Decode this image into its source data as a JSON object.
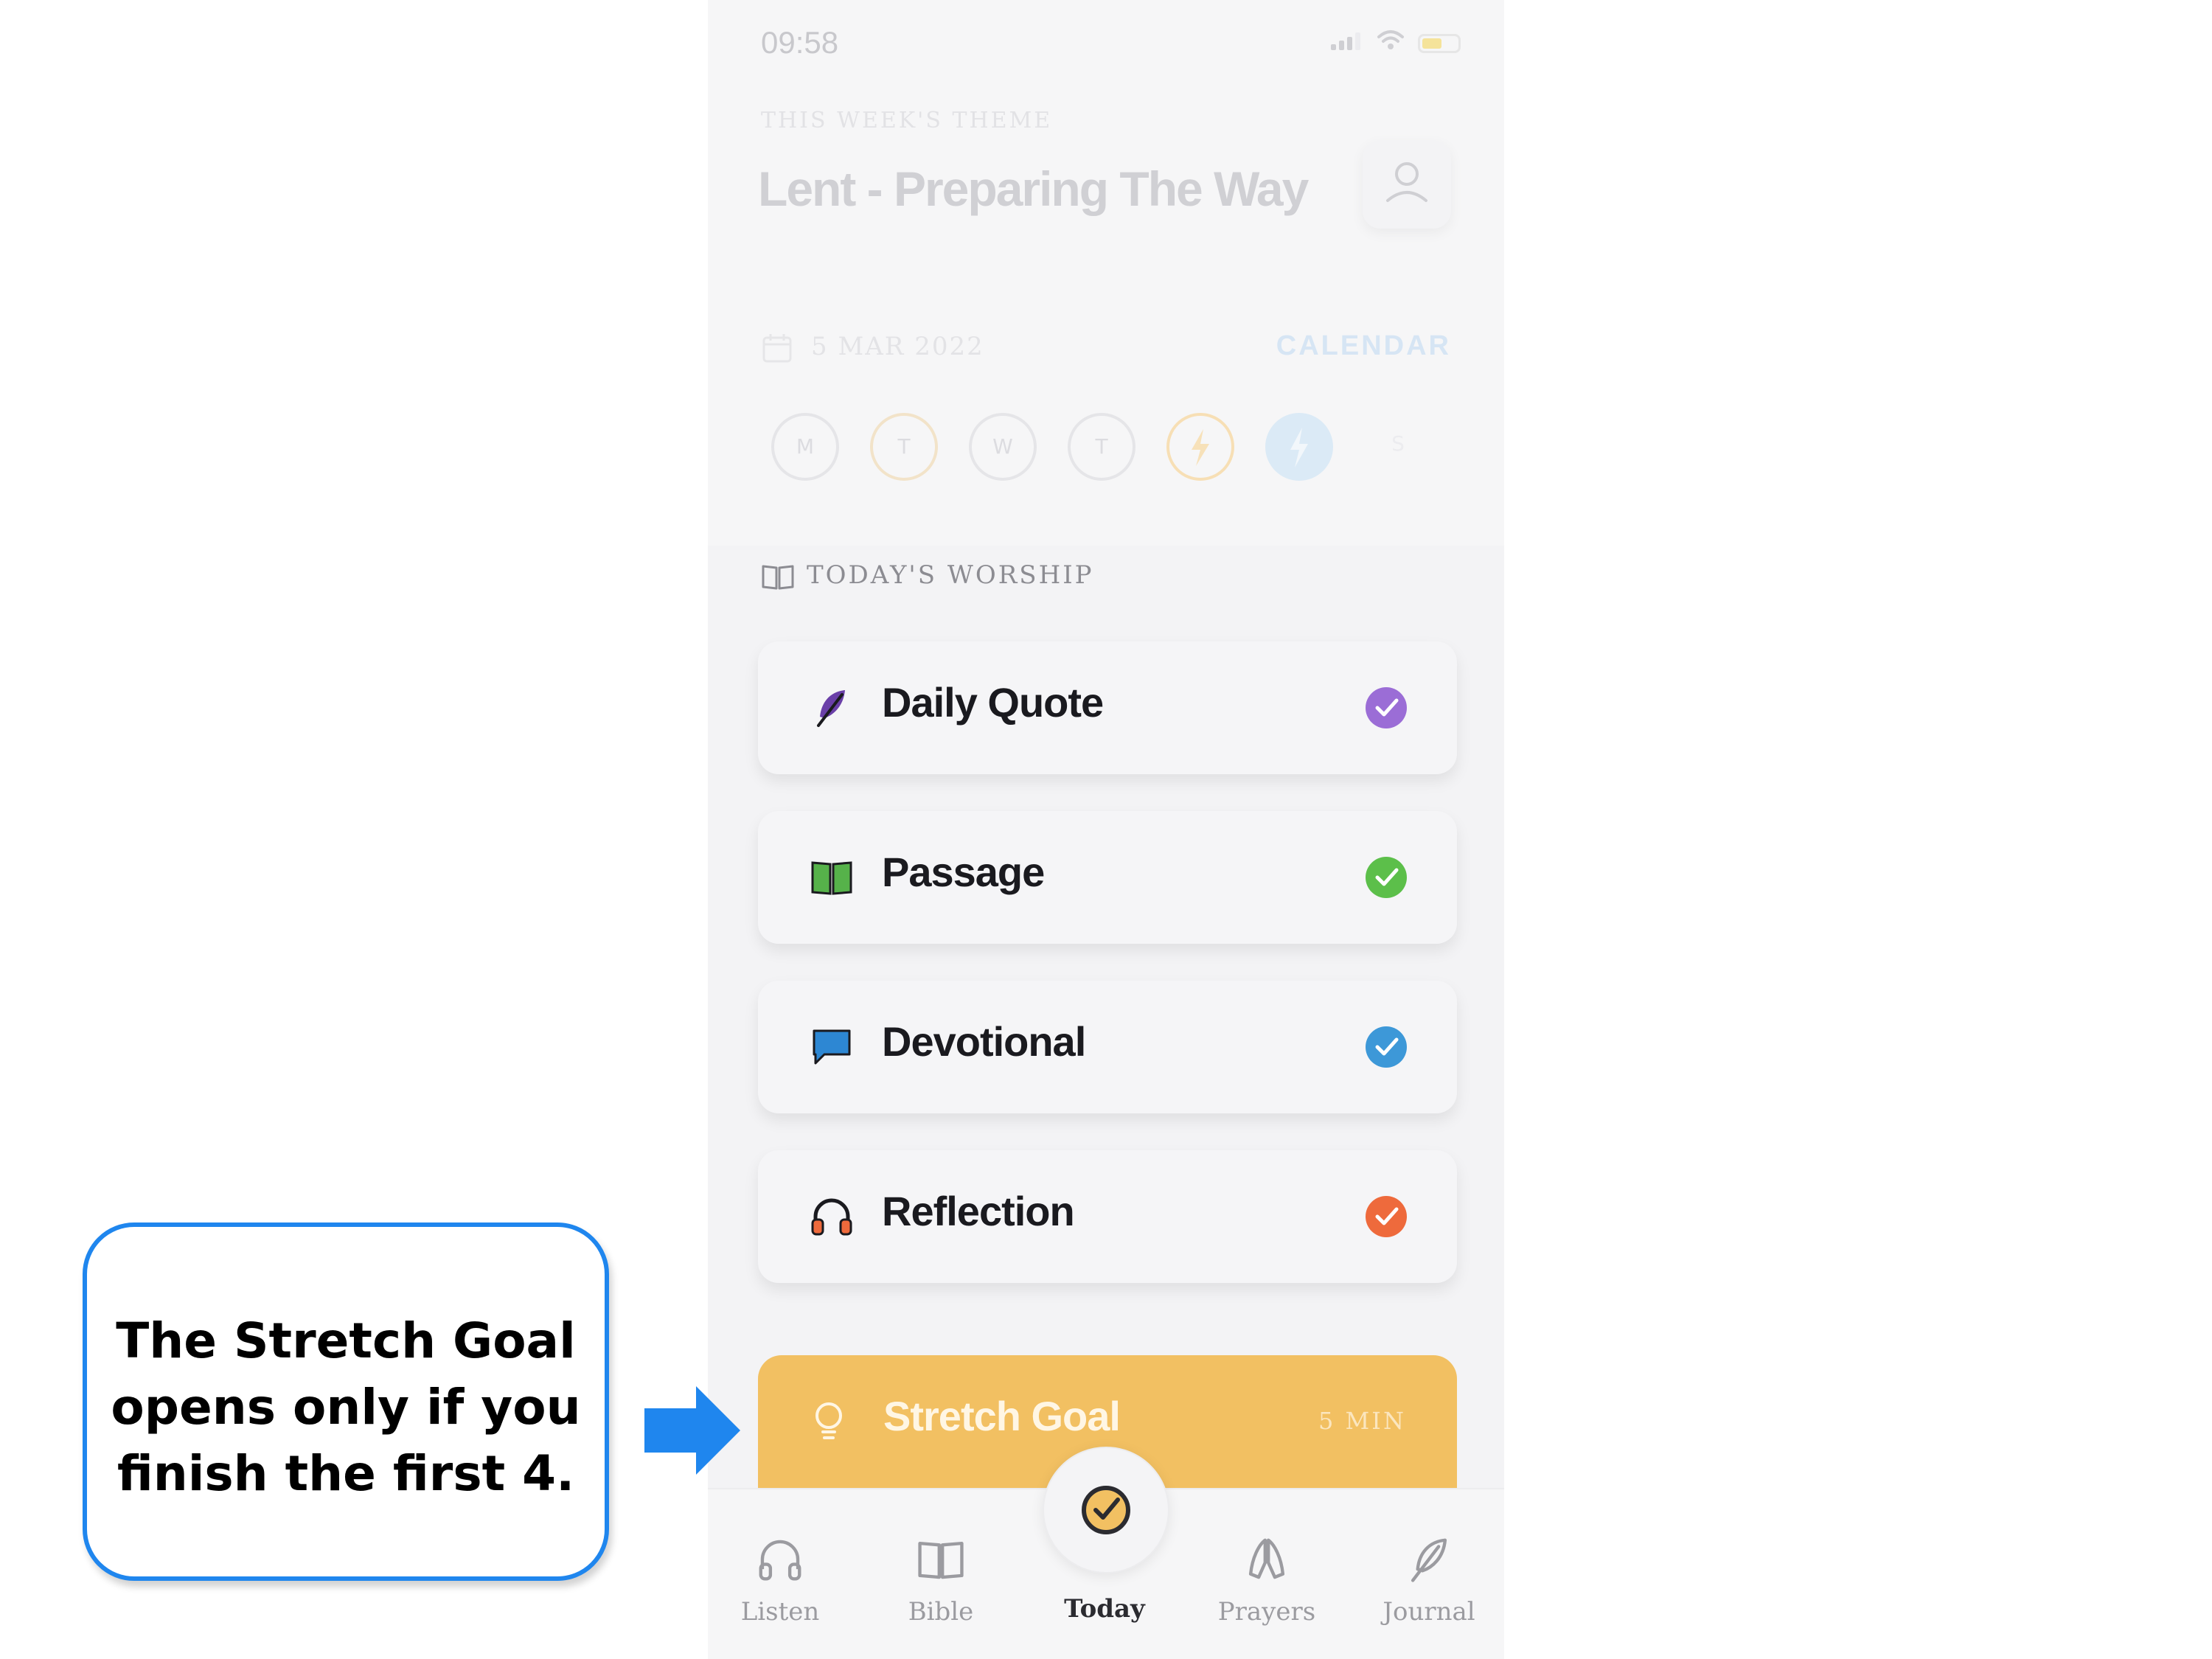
{
  "status_bar": {
    "time": "09:58"
  },
  "header": {
    "theme_label": "THIS WEEK'S THEME",
    "theme_title": "Lent - Preparing The Way"
  },
  "date_row": {
    "date": "5 MAR 2022",
    "calendar_link": "CALENDAR"
  },
  "week_days": [
    {
      "letter": "M"
    },
    {
      "letter": "T"
    },
    {
      "letter": "W"
    },
    {
      "letter": "T"
    },
    {
      "letter": ""
    },
    {
      "letter": ""
    },
    {
      "letter": "S"
    }
  ],
  "section": {
    "label": "TODAY'S WORSHIP"
  },
  "worship_items": [
    {
      "label": "Daily Quote",
      "icon": "feather-icon",
      "check_color": "#9b6dd6",
      "completed": true
    },
    {
      "label": "Passage",
      "icon": "book-icon",
      "check_color": "#5cbf4a",
      "completed": true
    },
    {
      "label": "Devotional",
      "icon": "chat-bubble-icon",
      "check_color": "#3d98d8",
      "completed": true
    },
    {
      "label": "Reflection",
      "icon": "headphones-icon",
      "check_color": "#ee6a3c",
      "completed": true
    }
  ],
  "stretch_goal": {
    "label": "Stretch Goal",
    "duration": "5 MIN",
    "color": "#f2c062"
  },
  "tabbar": {
    "tabs": [
      {
        "label": "Listen",
        "icon": "headphones-icon"
      },
      {
        "label": "Bible",
        "icon": "book-icon"
      },
      {
        "label": "Today",
        "icon": "check-circle-icon",
        "active": true
      },
      {
        "label": "Prayers",
        "icon": "praying-hands-icon"
      },
      {
        "label": "Journal",
        "icon": "feather-icon"
      }
    ]
  },
  "annotation": {
    "text_line1": "The Stretch Goal",
    "text_line2": "opens only if you",
    "text_line3": "finish the first 4.",
    "border_color": "#1f86ee"
  }
}
